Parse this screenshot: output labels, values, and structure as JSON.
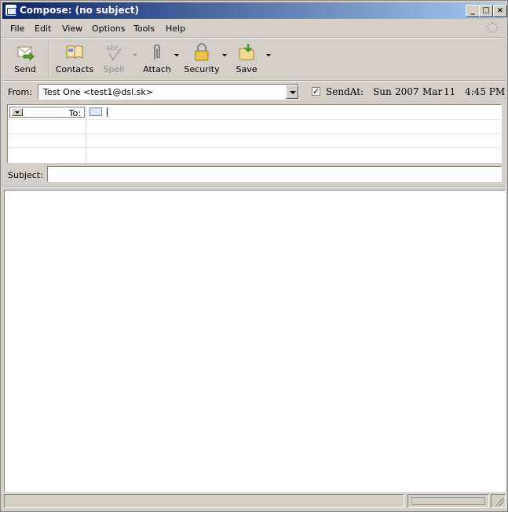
{
  "window": {
    "title": "Compose: (no subject)"
  },
  "menu": [
    {
      "label": "File"
    },
    {
      "label": "Edit"
    },
    {
      "label": "View"
    },
    {
      "label": "Options"
    },
    {
      "label": "Tools"
    },
    {
      "label": "Help"
    }
  ],
  "toolbar": {
    "send": "Send",
    "contacts": "Contacts",
    "spell": "Spell",
    "attach": "Attach",
    "security": "Security",
    "save": "Save"
  },
  "from": {
    "label": "From:",
    "value": "Test One <test1@dsl.sk>"
  },
  "sendat": {
    "checked": true,
    "label": "SendAt:",
    "day": "Sun",
    "year": "2007",
    "month": "Mar",
    "date": "11",
    "time": "4:45 PM"
  },
  "recipients": {
    "type_label": "To:",
    "value": ""
  },
  "subject": {
    "label": "Subject:",
    "value": ""
  },
  "icons": [
    "send-icon",
    "contacts-icon",
    "spell-icon",
    "attach-icon",
    "security-icon",
    "save-icon",
    "address-card-icon",
    "throbber-icon"
  ]
}
